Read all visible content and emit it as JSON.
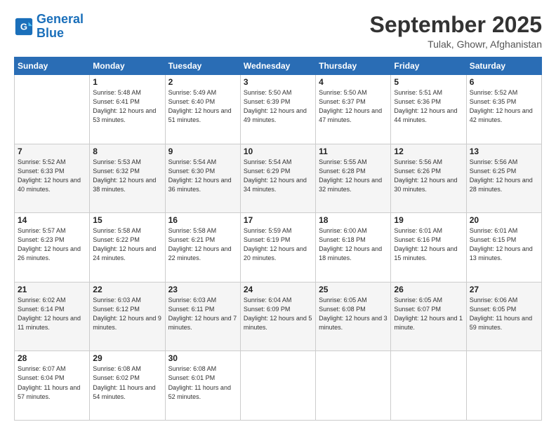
{
  "logo": {
    "line1": "General",
    "line2": "Blue"
  },
  "header": {
    "month": "September 2025",
    "location": "Tulak, Ghowr, Afghanistan"
  },
  "days_of_week": [
    "Sunday",
    "Monday",
    "Tuesday",
    "Wednesday",
    "Thursday",
    "Friday",
    "Saturday"
  ],
  "weeks": [
    [
      {
        "day": "",
        "sunrise": "",
        "sunset": "",
        "daylight": ""
      },
      {
        "day": "1",
        "sunrise": "Sunrise: 5:48 AM",
        "sunset": "Sunset: 6:41 PM",
        "daylight": "Daylight: 12 hours and 53 minutes."
      },
      {
        "day": "2",
        "sunrise": "Sunrise: 5:49 AM",
        "sunset": "Sunset: 6:40 PM",
        "daylight": "Daylight: 12 hours and 51 minutes."
      },
      {
        "day": "3",
        "sunrise": "Sunrise: 5:50 AM",
        "sunset": "Sunset: 6:39 PM",
        "daylight": "Daylight: 12 hours and 49 minutes."
      },
      {
        "day": "4",
        "sunrise": "Sunrise: 5:50 AM",
        "sunset": "Sunset: 6:37 PM",
        "daylight": "Daylight: 12 hours and 47 minutes."
      },
      {
        "day": "5",
        "sunrise": "Sunrise: 5:51 AM",
        "sunset": "Sunset: 6:36 PM",
        "daylight": "Daylight: 12 hours and 44 minutes."
      },
      {
        "day": "6",
        "sunrise": "Sunrise: 5:52 AM",
        "sunset": "Sunset: 6:35 PM",
        "daylight": "Daylight: 12 hours and 42 minutes."
      }
    ],
    [
      {
        "day": "7",
        "sunrise": "Sunrise: 5:52 AM",
        "sunset": "Sunset: 6:33 PM",
        "daylight": "Daylight: 12 hours and 40 minutes."
      },
      {
        "day": "8",
        "sunrise": "Sunrise: 5:53 AM",
        "sunset": "Sunset: 6:32 PM",
        "daylight": "Daylight: 12 hours and 38 minutes."
      },
      {
        "day": "9",
        "sunrise": "Sunrise: 5:54 AM",
        "sunset": "Sunset: 6:30 PM",
        "daylight": "Daylight: 12 hours and 36 minutes."
      },
      {
        "day": "10",
        "sunrise": "Sunrise: 5:54 AM",
        "sunset": "Sunset: 6:29 PM",
        "daylight": "Daylight: 12 hours and 34 minutes."
      },
      {
        "day": "11",
        "sunrise": "Sunrise: 5:55 AM",
        "sunset": "Sunset: 6:28 PM",
        "daylight": "Daylight: 12 hours and 32 minutes."
      },
      {
        "day": "12",
        "sunrise": "Sunrise: 5:56 AM",
        "sunset": "Sunset: 6:26 PM",
        "daylight": "Daylight: 12 hours and 30 minutes."
      },
      {
        "day": "13",
        "sunrise": "Sunrise: 5:56 AM",
        "sunset": "Sunset: 6:25 PM",
        "daylight": "Daylight: 12 hours and 28 minutes."
      }
    ],
    [
      {
        "day": "14",
        "sunrise": "Sunrise: 5:57 AM",
        "sunset": "Sunset: 6:23 PM",
        "daylight": "Daylight: 12 hours and 26 minutes."
      },
      {
        "day": "15",
        "sunrise": "Sunrise: 5:58 AM",
        "sunset": "Sunset: 6:22 PM",
        "daylight": "Daylight: 12 hours and 24 minutes."
      },
      {
        "day": "16",
        "sunrise": "Sunrise: 5:58 AM",
        "sunset": "Sunset: 6:21 PM",
        "daylight": "Daylight: 12 hours and 22 minutes."
      },
      {
        "day": "17",
        "sunrise": "Sunrise: 5:59 AM",
        "sunset": "Sunset: 6:19 PM",
        "daylight": "Daylight: 12 hours and 20 minutes."
      },
      {
        "day": "18",
        "sunrise": "Sunrise: 6:00 AM",
        "sunset": "Sunset: 6:18 PM",
        "daylight": "Daylight: 12 hours and 18 minutes."
      },
      {
        "day": "19",
        "sunrise": "Sunrise: 6:01 AM",
        "sunset": "Sunset: 6:16 PM",
        "daylight": "Daylight: 12 hours and 15 minutes."
      },
      {
        "day": "20",
        "sunrise": "Sunrise: 6:01 AM",
        "sunset": "Sunset: 6:15 PM",
        "daylight": "Daylight: 12 hours and 13 minutes."
      }
    ],
    [
      {
        "day": "21",
        "sunrise": "Sunrise: 6:02 AM",
        "sunset": "Sunset: 6:14 PM",
        "daylight": "Daylight: 12 hours and 11 minutes."
      },
      {
        "day": "22",
        "sunrise": "Sunrise: 6:03 AM",
        "sunset": "Sunset: 6:12 PM",
        "daylight": "Daylight: 12 hours and 9 minutes."
      },
      {
        "day": "23",
        "sunrise": "Sunrise: 6:03 AM",
        "sunset": "Sunset: 6:11 PM",
        "daylight": "Daylight: 12 hours and 7 minutes."
      },
      {
        "day": "24",
        "sunrise": "Sunrise: 6:04 AM",
        "sunset": "Sunset: 6:09 PM",
        "daylight": "Daylight: 12 hours and 5 minutes."
      },
      {
        "day": "25",
        "sunrise": "Sunrise: 6:05 AM",
        "sunset": "Sunset: 6:08 PM",
        "daylight": "Daylight: 12 hours and 3 minutes."
      },
      {
        "day": "26",
        "sunrise": "Sunrise: 6:05 AM",
        "sunset": "Sunset: 6:07 PM",
        "daylight": "Daylight: 12 hours and 1 minute."
      },
      {
        "day": "27",
        "sunrise": "Sunrise: 6:06 AM",
        "sunset": "Sunset: 6:05 PM",
        "daylight": "Daylight: 11 hours and 59 minutes."
      }
    ],
    [
      {
        "day": "28",
        "sunrise": "Sunrise: 6:07 AM",
        "sunset": "Sunset: 6:04 PM",
        "daylight": "Daylight: 11 hours and 57 minutes."
      },
      {
        "day": "29",
        "sunrise": "Sunrise: 6:08 AM",
        "sunset": "Sunset: 6:02 PM",
        "daylight": "Daylight: 11 hours and 54 minutes."
      },
      {
        "day": "30",
        "sunrise": "Sunrise: 6:08 AM",
        "sunset": "Sunset: 6:01 PM",
        "daylight": "Daylight: 11 hours and 52 minutes."
      },
      {
        "day": "",
        "sunrise": "",
        "sunset": "",
        "daylight": ""
      },
      {
        "day": "",
        "sunrise": "",
        "sunset": "",
        "daylight": ""
      },
      {
        "day": "",
        "sunrise": "",
        "sunset": "",
        "daylight": ""
      },
      {
        "day": "",
        "sunrise": "",
        "sunset": "",
        "daylight": ""
      }
    ]
  ]
}
